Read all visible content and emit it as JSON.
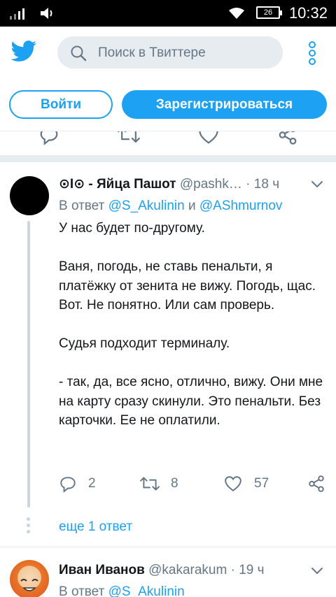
{
  "status_bar": {
    "battery": "26",
    "time": "10:32"
  },
  "header": {
    "search_placeholder": "Поиск в Твиттере"
  },
  "auth": {
    "login_label": "Войти",
    "signup_label": "Зарегистрироваться"
  },
  "tweet": {
    "name": "⊙I⊙ - Яйца Пашот",
    "handle": "@pashk…",
    "separator": "·",
    "time": "18 ч",
    "reply_prefix": "В ответ",
    "reply_mention_1": "@S_Akulinin",
    "reply_and": "и",
    "reply_mention_2": "@AShmurnov",
    "paragraphs": [
      "У нас будет по-другому.",
      "Ваня, погодь, не ставь пенальти, я платёжку от зенита не вижу. Погодь, щас. Вот. Не понятно. Или сам проверь.",
      "Судья подходит терминалу.",
      "- так, да, все ясно, отлично, вижу. Они мне на карту сразу скинули. Это пенальти. Без карточки. Ее не оплатили."
    ],
    "replies": "2",
    "retweets": "8",
    "likes": "57",
    "more_replies": "еще 1 ответ"
  },
  "tweet2": {
    "name": "Иван Иванов",
    "handle": "@kakarakum",
    "separator": "·",
    "time": "19 ч",
    "reply_prefix": "В ответ",
    "reply_mention_1": "@S_Akulinin"
  },
  "colors": {
    "accent": "#1da1f2",
    "secondary_text": "#657786",
    "divider": "#e6ecf0"
  },
  "icons": [
    "signal-icon",
    "volume-icon",
    "wifi-icon",
    "battery-icon",
    "twitter-logo-icon",
    "search-icon",
    "more-vertical-icon",
    "reply-icon",
    "retweet-icon",
    "like-icon",
    "share-icon",
    "chevron-down-icon"
  ]
}
